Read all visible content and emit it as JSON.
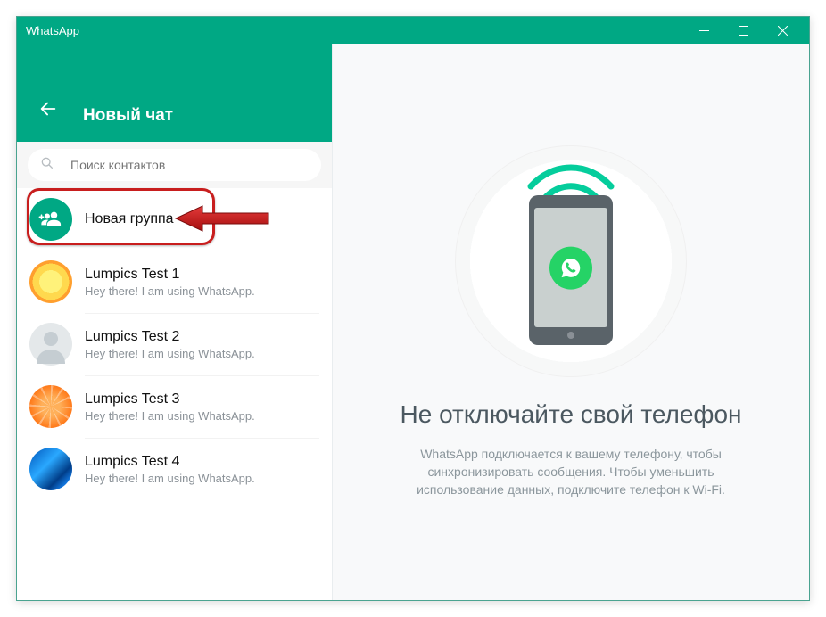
{
  "window": {
    "title": "WhatsApp"
  },
  "left": {
    "title": "Новый чат",
    "search_placeholder": "Поиск контактов",
    "new_group": "Новая группа",
    "contacts": [
      {
        "name": "Lumpics Test 1",
        "status": "Hey there! I am using WhatsApp."
      },
      {
        "name": "Lumpics Test 2",
        "status": "Hey there! I am using WhatsApp."
      },
      {
        "name": "Lumpics Test 3",
        "status": "Hey there! I am using WhatsApp."
      },
      {
        "name": "Lumpics Test 4",
        "status": "Hey there! I am using WhatsApp."
      }
    ]
  },
  "right": {
    "heading": "Не отключайте свой телефон",
    "body": "WhatsApp подключается к вашему телефону, чтобы синхронизировать сообщения. Чтобы уменьшить использование данных, подключите телефон к Wi-Fi."
  }
}
